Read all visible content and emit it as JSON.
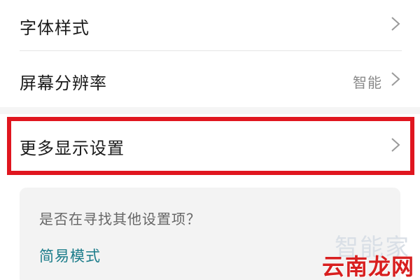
{
  "settings": {
    "items": [
      {
        "label": "字体样式",
        "value": ""
      },
      {
        "label": "屏幕分辨率",
        "value": "智能"
      },
      {
        "label": "更多显示设置",
        "value": ""
      }
    ]
  },
  "card": {
    "question": "是否在寻找其他设置项？",
    "link": "简易模式"
  },
  "watermark": {
    "faint": "智能家",
    "main": "云南龙网"
  },
  "colors": {
    "highlight_border": "#e0161f",
    "link": "#1b7c8a",
    "watermark_main": "#d81f1f"
  },
  "icons": {
    "row_chevron": "chevron-right-icon"
  }
}
